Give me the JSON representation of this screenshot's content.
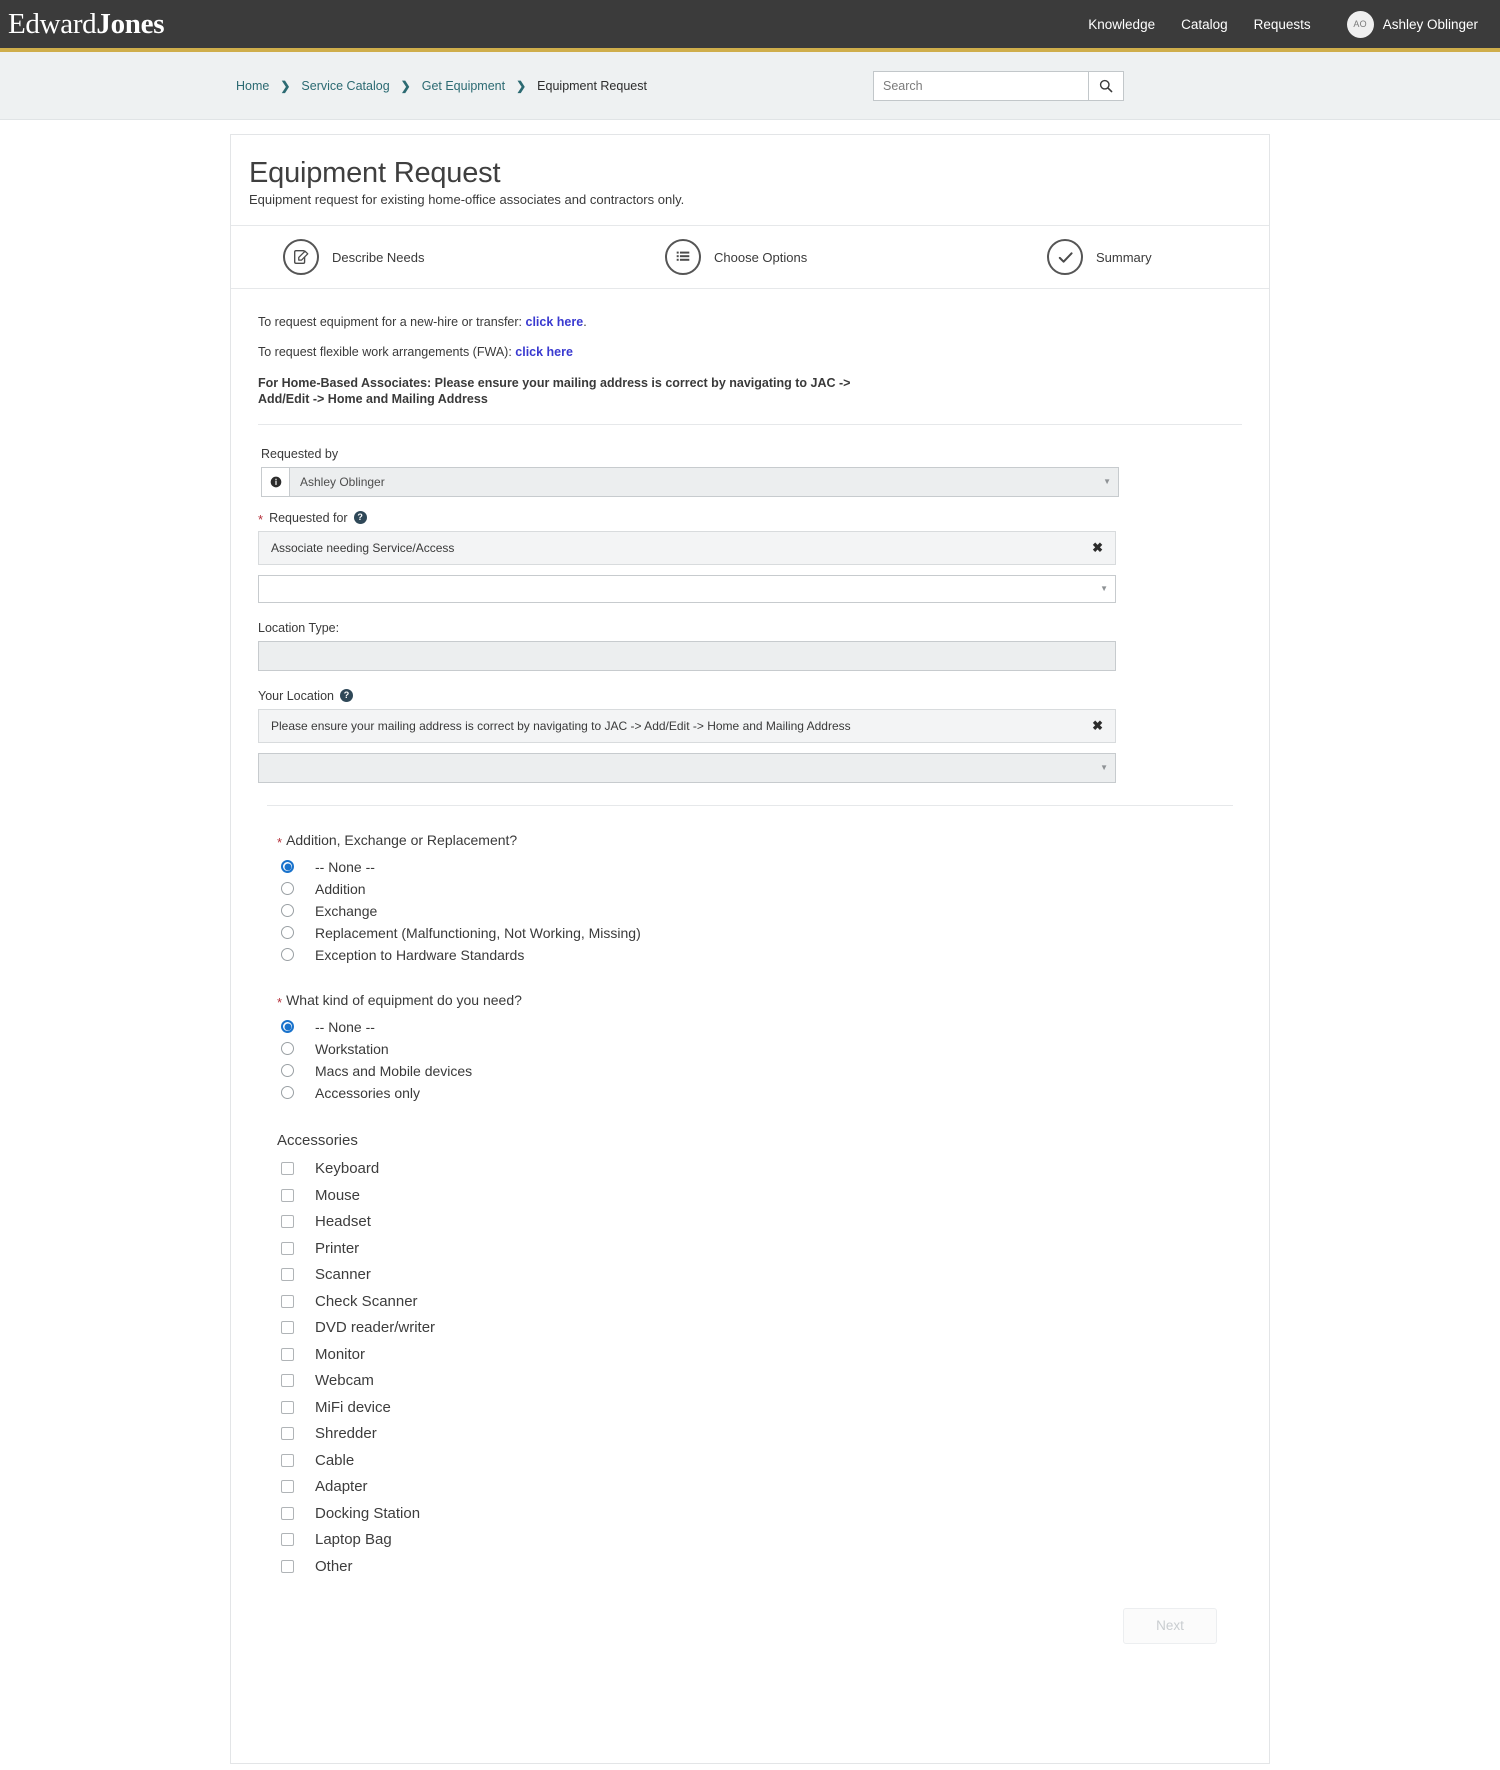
{
  "header": {
    "logo_first": "Edward",
    "logo_second": "Jones",
    "nav": [
      {
        "label": "Knowledge"
      },
      {
        "label": "Catalog"
      },
      {
        "label": "Requests"
      }
    ],
    "user": {
      "initials": "AO",
      "name": "Ashley Oblinger"
    },
    "accent_color": "#cfae4b",
    "bar_color": "#3b3b3b"
  },
  "breadcrumb": {
    "items": [
      {
        "label": "Home",
        "current": false
      },
      {
        "label": "Service Catalog",
        "current": false
      },
      {
        "label": "Get Equipment",
        "current": false
      },
      {
        "label": "Equipment Request",
        "current": true
      }
    ],
    "separator": "❯"
  },
  "search": {
    "placeholder": "Search",
    "value": ""
  },
  "page": {
    "title": "Equipment Request",
    "subtitle": "Equipment request for existing home-office associates and contractors only."
  },
  "steps": [
    {
      "label": "Describe Needs",
      "icon": "edit-note-icon"
    },
    {
      "label": "Choose Options",
      "icon": "list-icon"
    },
    {
      "label": "Summary",
      "icon": "check-icon"
    }
  ],
  "intro": {
    "line1_text": "To request equipment for a new-hire or transfer: ",
    "line1_link": "click here",
    "line1_tail": ".",
    "line2_text": "To request flexible work arrangements (FWA): ",
    "line2_link": "click here",
    "line3": "For Home-Based Associates: Please ensure your mailing address is correct by navigating to JAC -> Add/Edit -> Home and Mailing Address"
  },
  "form": {
    "requested_by": {
      "label": "Requested by",
      "value": "Ashley Oblinger"
    },
    "requested_for": {
      "label": "Requested for",
      "required": true,
      "hint": "Associate needing Service/Access",
      "value": "",
      "clear": "✖"
    },
    "location_type": {
      "label": "Location Type:",
      "value": ""
    },
    "your_location": {
      "label": "Your Location",
      "hint": "Please ensure your mailing address is correct by navigating to JAC -> Add/Edit -> Home and Mailing Address",
      "value": "",
      "clear": "✖"
    }
  },
  "choice_groups": [
    {
      "title": "Addition, Exchange or Replacement?",
      "required": true,
      "options": [
        {
          "label": "-- None --",
          "selected": true
        },
        {
          "label": "Addition",
          "selected": false
        },
        {
          "label": "Exchange",
          "selected": false
        },
        {
          "label": "Replacement (Malfunctioning, Not Working, Missing)",
          "selected": false
        },
        {
          "label": "Exception to Hardware Standards",
          "selected": false
        }
      ]
    },
    {
      "title": "What kind of equipment do you need?",
      "required": true,
      "options": [
        {
          "label": "-- None --",
          "selected": true
        },
        {
          "label": "Workstation",
          "selected": false
        },
        {
          "label": "Macs and Mobile devices",
          "selected": false
        },
        {
          "label": "Accessories only",
          "selected": false
        }
      ]
    }
  ],
  "accessories": {
    "title": "Accessories",
    "items": [
      {
        "label": "Keyboard",
        "checked": false
      },
      {
        "label": "Mouse",
        "checked": false
      },
      {
        "label": "Headset",
        "checked": false
      },
      {
        "label": "Printer",
        "checked": false
      },
      {
        "label": "Scanner",
        "checked": false
      },
      {
        "label": "Check Scanner",
        "checked": false
      },
      {
        "label": "DVD reader/writer",
        "checked": false
      },
      {
        "label": "Monitor",
        "checked": false
      },
      {
        "label": "Webcam",
        "checked": false
      },
      {
        "label": "MiFi device",
        "checked": false
      },
      {
        "label": "Shredder",
        "checked": false
      },
      {
        "label": "Cable",
        "checked": false
      },
      {
        "label": "Adapter",
        "checked": false
      },
      {
        "label": "Docking Station",
        "checked": false
      },
      {
        "label": "Laptop Bag",
        "checked": false
      },
      {
        "label": "Other",
        "checked": false
      }
    ]
  },
  "footer": {
    "next_label": "Next",
    "next_disabled": true
  }
}
